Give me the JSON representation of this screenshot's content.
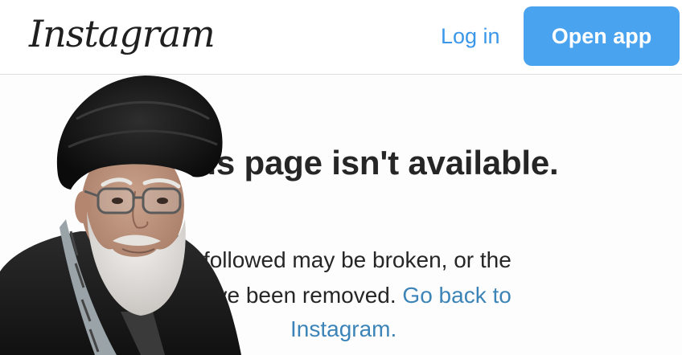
{
  "header": {
    "logo_text": "Instagram",
    "login_label": "Log in",
    "open_app_label": "Open app"
  },
  "main": {
    "heading": "his page isn't available.",
    "line1": "you followed may be broken, or the",
    "line2_prefix": "ay have been removed.",
    "go_back_label": "Go back to",
    "line3_link": "Instagram."
  },
  "colors": {
    "accent_blue": "#4aa3ef",
    "link_blue": "#3c84b7",
    "text_dark": "#262626"
  }
}
